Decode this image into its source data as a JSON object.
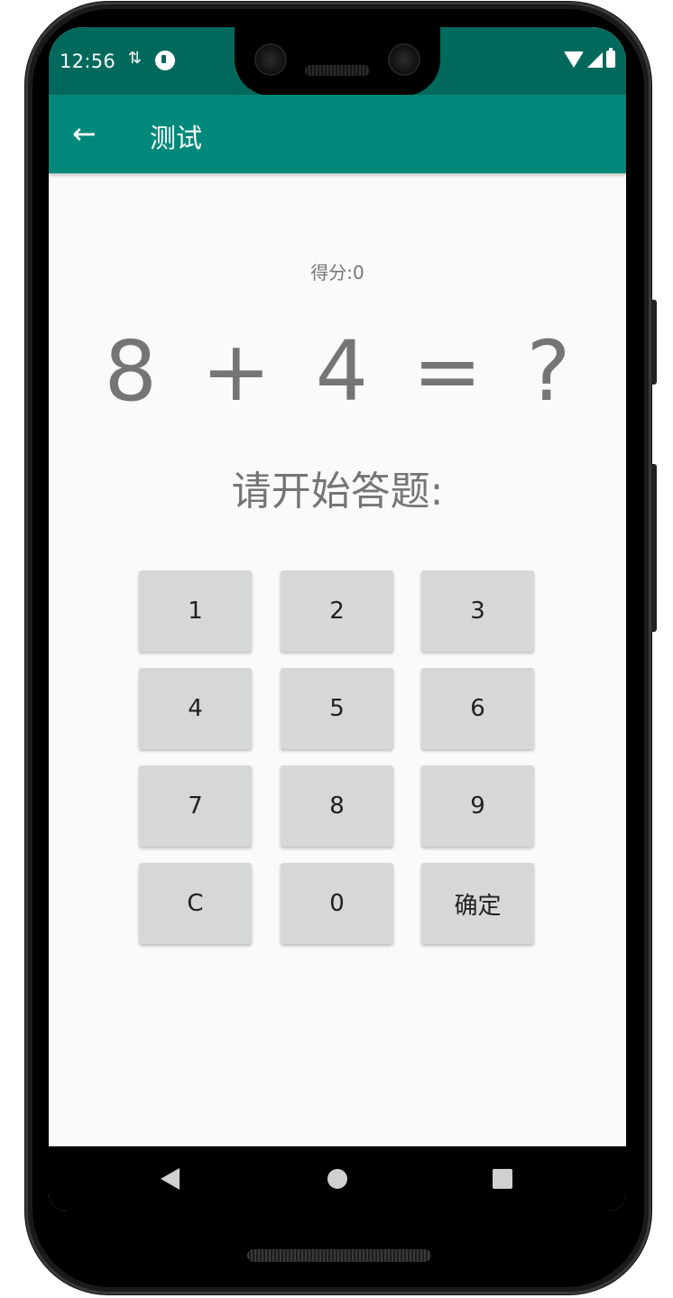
{
  "status_bar": {
    "time": "12:56",
    "sync_glyph": "⇅",
    "color": "#00695c"
  },
  "app_bar": {
    "title": "测试",
    "back_glyph": "←",
    "color": "#00897b"
  },
  "quiz": {
    "score_text": "得分:0",
    "question_text": "8 + 4 = ?",
    "prompt_text": "请开始答题:"
  },
  "keypad": {
    "keys": [
      "1",
      "2",
      "3",
      "4",
      "5",
      "6",
      "7",
      "8",
      "9",
      "C",
      "0",
      "确定"
    ]
  },
  "icons": {
    "status": [
      "sync-icon",
      "notification-badge-icon",
      "wifi-icon",
      "signal-icon",
      "battery-icon"
    ],
    "nav": [
      "back-triangle-icon",
      "home-circle-icon",
      "recents-square-icon"
    ]
  }
}
